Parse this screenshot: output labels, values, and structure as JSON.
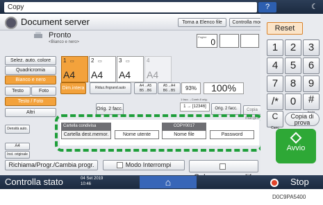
{
  "topbar": {
    "tab_label": "Copy",
    "help_label": "?",
    "moon_icon": "moon-icon"
  },
  "header": {
    "title": "Document server",
    "torna_label": "Torna a Elenco file",
    "controlla_label": "Controlla modi"
  },
  "status": {
    "pronto": "Pronto",
    "sub": "<Bianco e nero>",
    "pages_label": "Pagine",
    "pages_value": "0"
  },
  "left_buttons": [
    {
      "label": "Selez. auto. colore"
    },
    {
      "label": "Quadricromia"
    },
    {
      "label": "Bianco e nero"
    },
    {
      "label": "Testo"
    },
    {
      "label": "Foto"
    },
    {
      "label": "Testo / Foto"
    },
    {
      "label": "Altri"
    },
    {
      "label": "Densità auto."
    },
    {
      "label": "A4"
    },
    {
      "label": "Inst. originale"
    }
  ],
  "paper": [
    {
      "num": "1",
      "size": "A4",
      "selected": true
    },
    {
      "num": "2",
      "size": "A4",
      "selected": false
    },
    {
      "num": "3",
      "size": "A4",
      "selected": false
    },
    {
      "num": "4",
      "size": "A4",
      "selected": false
    }
  ],
  "ratio": {
    "dim_intera": "Dim.intera",
    "rid_ingr": "Riduz./Ingrand.auto",
    "b1_top": "A4→A5",
    "b1_bot": "B5→B6",
    "b2_top": "A5→A4",
    "b2_bot": "B6→B5",
    "pct_small": "93%",
    "pct_big": "100%"
  },
  "copies": {
    "orig_2facc": "Orig. 2 facc.",
    "fact_label": "1 facc.→Comb.8 orig.",
    "fact_value": "1 → [12346]",
    "orig_2facc2": "Orig. 2 facc.",
    "copia": "Copia margini"
  },
  "doc_list": {
    "cartella_condivisa": "Cartella condivisa",
    "copy_code": "COPY0017",
    "cartella_dest": "Cartella dest.memor.",
    "nome_utente": "Nome utente",
    "nome_file": "Nome file",
    "password": "Password"
  },
  "bottom_row": {
    "richiama": "Richiama/Progr./Cambia progr.",
    "modo": "Modo Interrompi",
    "scherm": "Scherm.semplif."
  },
  "keypad": {
    "reset": "Reset",
    "keys": [
      "1",
      "2",
      "3",
      "4",
      "5",
      "6",
      "7",
      "8",
      "9",
      "/*",
      "0",
      "#"
    ],
    "hash_sub": "Invio",
    "canc": "C",
    "canc_sub": "Canc",
    "copia_prova": "Copia di prova",
    "avvio": "Avvio"
  },
  "bottombar": {
    "controlla_stato": "Controlla stato",
    "date": "04 Set 2019",
    "time": "10:46",
    "stop": "Stop"
  },
  "footer_code": "D0C9PA5400"
}
